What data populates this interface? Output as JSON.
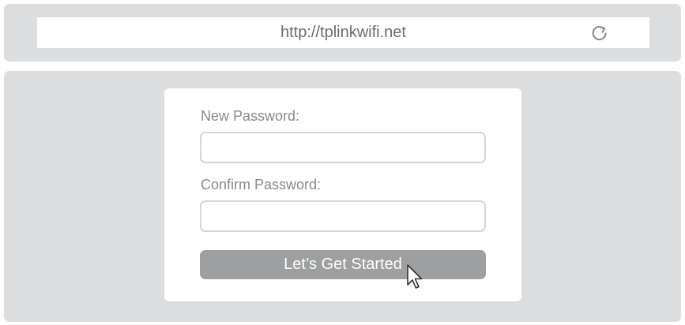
{
  "browser": {
    "url": "http://tplinkwifi.net",
    "reload_icon": "reload-icon"
  },
  "form": {
    "new_password_label": "New Password:",
    "new_password_value": "",
    "confirm_password_label": "Confirm Password:",
    "confirm_password_value": "",
    "submit_label": "Let’s Get Started"
  },
  "colors": {
    "panel_background": "#dcdddf",
    "button_background": "#9e9fa1",
    "label_text": "#8a8a8a",
    "input_border": "#d6d6d6"
  },
  "icons": [
    "reload-icon",
    "mouse-pointer-icon"
  ]
}
